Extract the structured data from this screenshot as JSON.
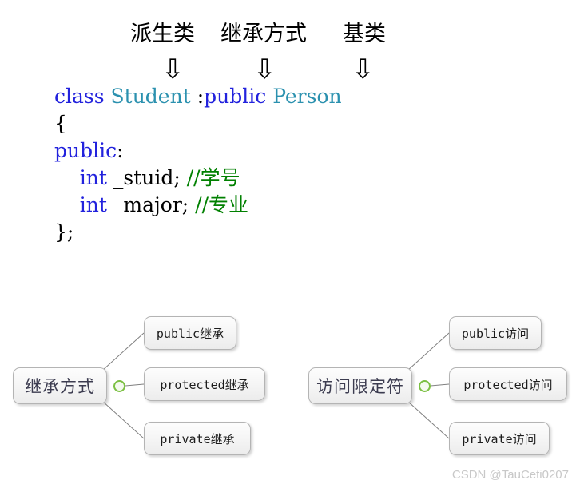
{
  "annotations": {
    "labels": [
      {
        "text": "派生类"
      },
      {
        "text": "继承方式"
      },
      {
        "text": "基类"
      }
    ],
    "arrow_glyph": "⇩"
  },
  "code": {
    "lines": [
      {
        "tokens": [
          {
            "text": "class ",
            "kind": "keyword"
          },
          {
            "text": "Student",
            "kind": "type"
          },
          {
            "text": " :",
            "kind": "plain"
          },
          {
            "text": "public",
            "kind": "keyword"
          },
          {
            "text": " ",
            "kind": "plain"
          },
          {
            "text": "Person",
            "kind": "type"
          }
        ]
      },
      {
        "tokens": [
          {
            "text": "{",
            "kind": "plain"
          }
        ]
      },
      {
        "tokens": [
          {
            "text": "public",
            "kind": "keyword"
          },
          {
            "text": ":",
            "kind": "plain"
          }
        ]
      },
      {
        "tokens": [
          {
            "text": "    ",
            "kind": "plain"
          },
          {
            "text": "int",
            "kind": "keyword"
          },
          {
            "text": " _stuid; ",
            "kind": "plain"
          },
          {
            "text": "//学号",
            "kind": "comment"
          }
        ]
      },
      {
        "tokens": [
          {
            "text": "    ",
            "kind": "plain"
          },
          {
            "text": "int",
            "kind": "keyword"
          },
          {
            "text": " _major; ",
            "kind": "plain"
          },
          {
            "text": "//专业",
            "kind": "comment"
          }
        ]
      },
      {
        "tokens": [
          {
            "text": "};",
            "kind": "plain"
          }
        ]
      }
    ]
  },
  "mindmaps": [
    {
      "id": "inheritance-modes",
      "root": {
        "label": "继承方式"
      },
      "toggle": {
        "state": "expanded",
        "symbol": "−"
      },
      "children": [
        {
          "label": "public继承"
        },
        {
          "label": "protected继承"
        },
        {
          "label": "private继承"
        }
      ]
    },
    {
      "id": "access-specifiers",
      "root": {
        "label": "访问限定符"
      },
      "toggle": {
        "state": "expanded",
        "symbol": "−"
      },
      "children": [
        {
          "label": "public访问"
        },
        {
          "label": "protected访问"
        },
        {
          "label": "private访问"
        }
      ]
    }
  ],
  "watermark": {
    "text": "CSDN @TauCeti0207"
  },
  "colors": {
    "background": "#ffffff",
    "keyword": "#2222dd",
    "type": "#2b91af",
    "comment": "#008000",
    "plain": "#000000",
    "node_border": "#b4b4b4",
    "node_fill": "#f2f2f2",
    "connector": "#808080",
    "toggle_green": "#7cc043",
    "watermark": "#c8c8c8"
  }
}
